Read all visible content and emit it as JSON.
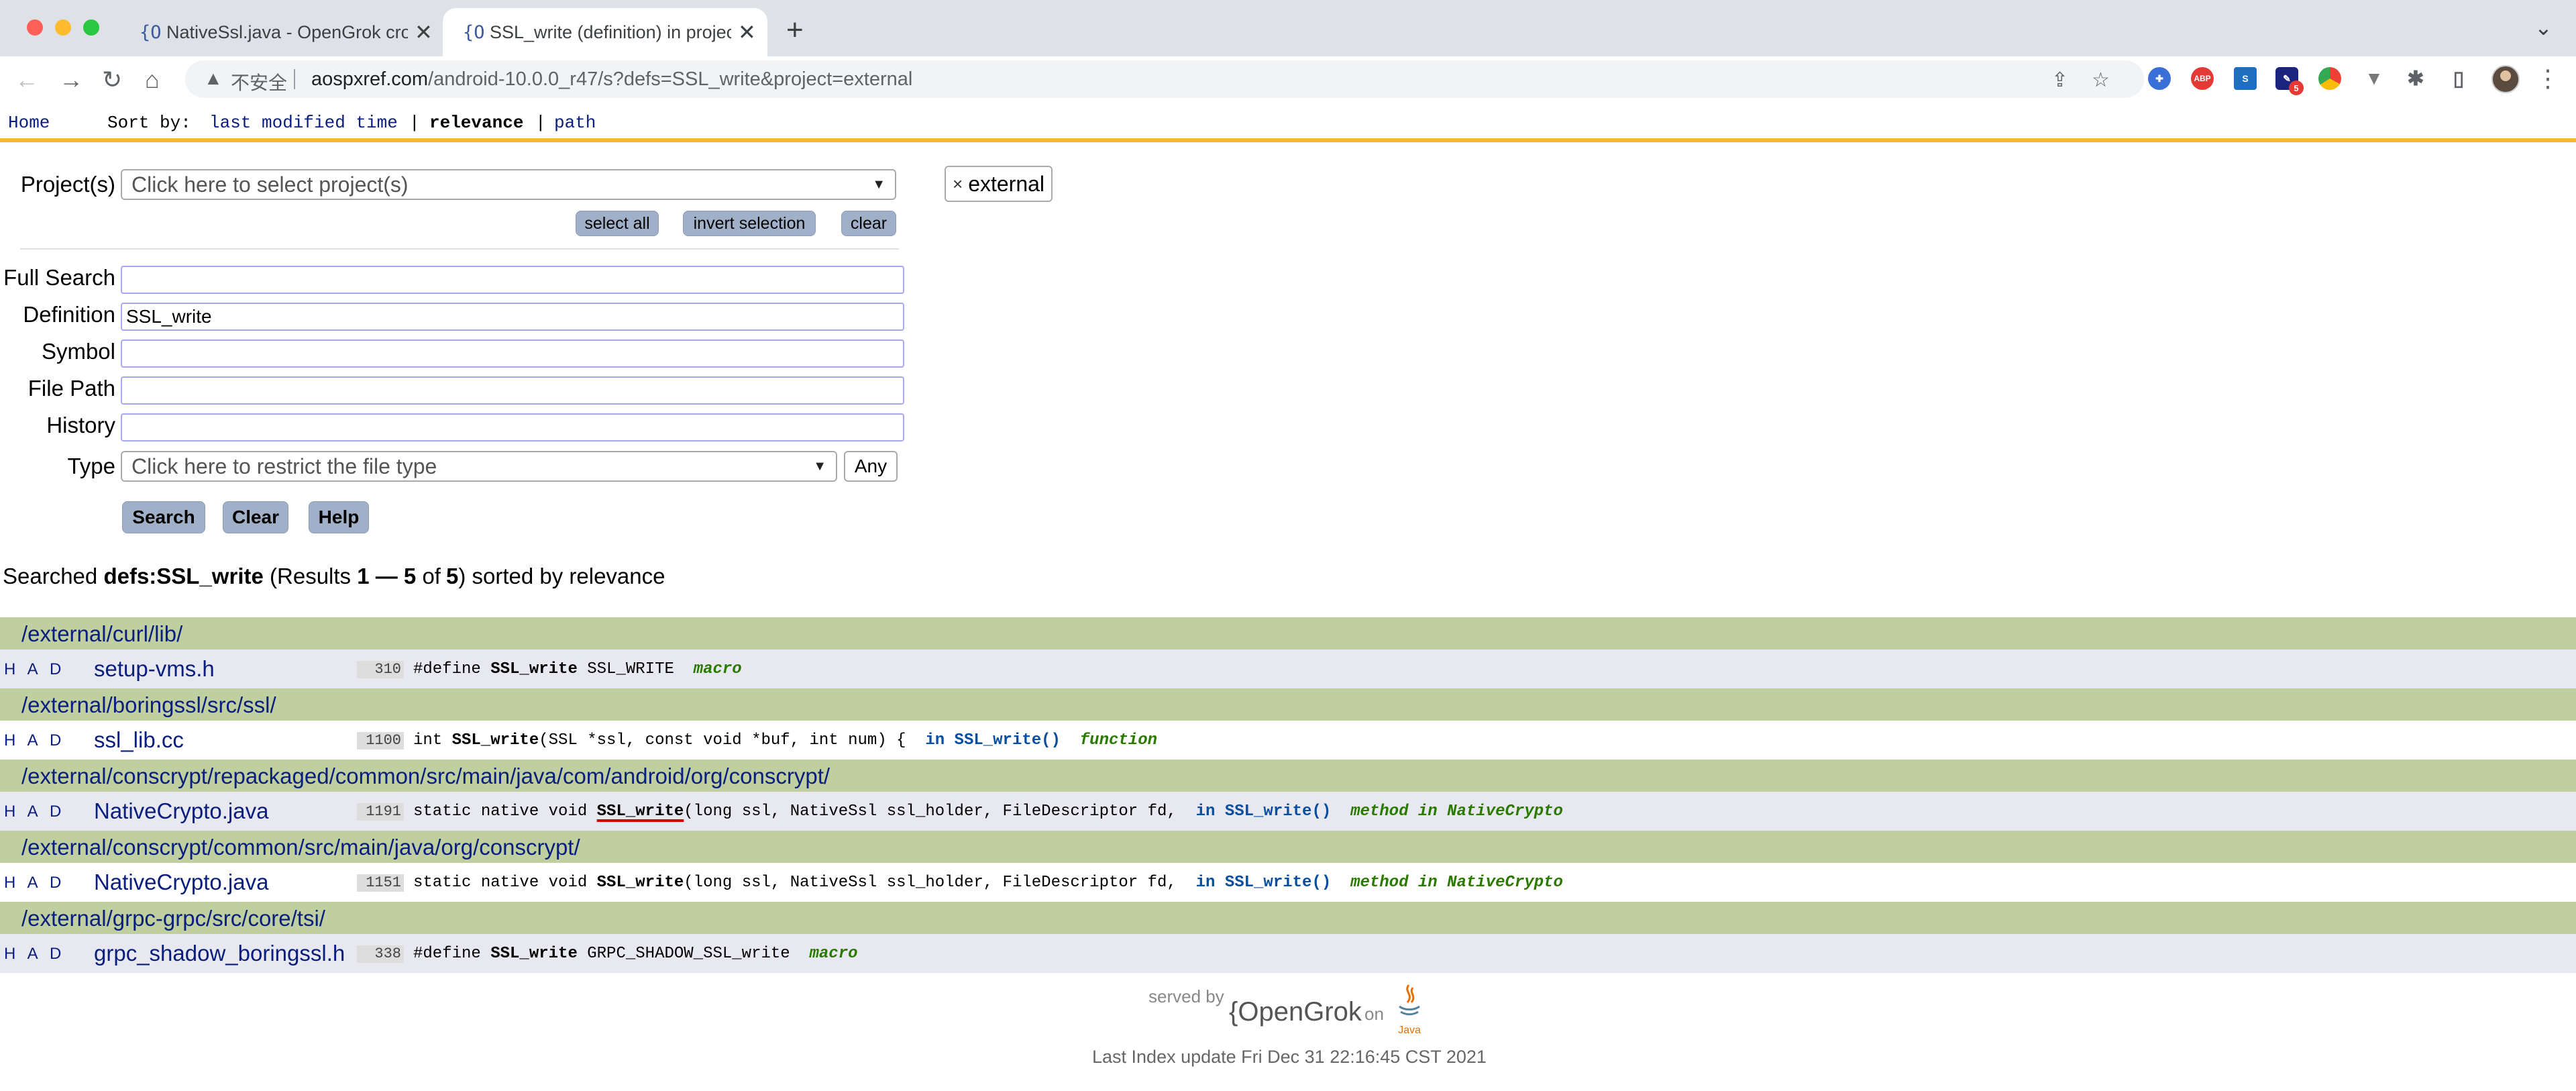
{
  "browser": {
    "tabs": [
      {
        "favicon": "{O",
        "title": "NativeSsl.java - OpenGrok cros",
        "close": "✕"
      },
      {
        "favicon": "{O",
        "title": "SSL_write (definition) in projec",
        "close": "✕"
      }
    ],
    "new_tab": "+",
    "tab_menu": "⌄",
    "address": {
      "insecure_label": "不安全",
      "host": "aospxref.com",
      "path": "/android-10.0.0_r47/s?defs=SSL_write&project=external"
    },
    "icons": [
      "back-icon",
      "forward-icon",
      "reload-icon",
      "home-icon",
      "warning-icon",
      "share-icon",
      "star-icon",
      "puzzle-icon",
      "sidepanel-icon",
      "kebab-icon"
    ],
    "extension_badge": "5",
    "abp_label": "ABP"
  },
  "header": {
    "home": "Home",
    "sort_by": "Sort by:",
    "sort_options": [
      "last modified time",
      "relevance",
      "path"
    ],
    "separator": "|"
  },
  "form": {
    "projects_label": "Project(s)",
    "projects_placeholder": "Click here to select project(s)",
    "select_all": "select all",
    "invert_selection": "invert selection",
    "clear_projects": "clear",
    "selected_project": "external",
    "full_search_label": "Full Search",
    "full_search_value": "",
    "definition_label": "Definition",
    "definition_value": "SSL_write",
    "symbol_label": "Symbol",
    "symbol_value": "",
    "file_path_label": "File Path",
    "file_path_value": "",
    "history_label": "History",
    "history_value": "",
    "type_label": "Type",
    "type_placeholder": "Click here to restrict the file type",
    "any_button": "Any",
    "search_button": "Search",
    "clear_button": "Clear",
    "help_button": "Help"
  },
  "summary": {
    "prefix": "Searched",
    "query": "defs:SSL_write",
    "results_prefix": "(Results",
    "from": "1",
    "dash": "—",
    "to": "5",
    "of_label": "of",
    "total": "5",
    "suffix": ") sorted by relevance"
  },
  "results": [
    {
      "dir": "/external/curl/lib/",
      "had": "H A D",
      "file": "setup-vms.h",
      "line": "310",
      "code_pre": "#define ",
      "code_sym": "SSL_write",
      "code_post": " SSL_WRITE  ",
      "scope": "",
      "kind": "macro"
    },
    {
      "dir": "/external/boringssl/src/ssl/",
      "had": "H A D",
      "file": "ssl_lib.cc",
      "line": "1100",
      "code_pre": "int ",
      "code_sym": "SSL_write",
      "code_post": "(SSL *ssl, const void *buf, int num) {  ",
      "scope": "in SSL_write()",
      "kind": "function"
    },
    {
      "dir": "/external/conscrypt/repackaged/common/src/main/java/com/android/org/conscrypt/",
      "had": "H A D",
      "file": "NativeCrypto.java",
      "line": "1191",
      "code_pre": "static native void ",
      "code_sym": "SSL_write",
      "code_post": "(long ssl, NativeSsl ssl_holder, FileDescriptor fd,  ",
      "scope": "in SSL_write()",
      "kind": "method in NativeCrypto"
    },
    {
      "dir": "/external/conscrypt/common/src/main/java/org/conscrypt/",
      "had": "H A D",
      "file": "NativeCrypto.java",
      "line": "1151",
      "code_pre": "static native void ",
      "code_sym": "SSL_write",
      "code_post": "(long ssl, NativeSsl ssl_holder, FileDescriptor fd,  ",
      "scope": "in SSL_write()",
      "kind": "method in NativeCrypto"
    },
    {
      "dir": "/external/grpc-grpc/src/core/tsi/",
      "had": "H A D",
      "file": "grpc_shadow_boringssl.h",
      "line": "338",
      "code_pre": "#define ",
      "code_sym": "SSL_write",
      "code_post": " GRPC_SHADOW_SSL_write  ",
      "scope": "",
      "kind": "macro"
    }
  ],
  "footer": {
    "served_by": "served by",
    "brand": "{OpenGrok",
    "on": "on",
    "java": "Java",
    "last_index": "Last Index update Fri Dec 31 22:16:45 CST 2021"
  }
}
